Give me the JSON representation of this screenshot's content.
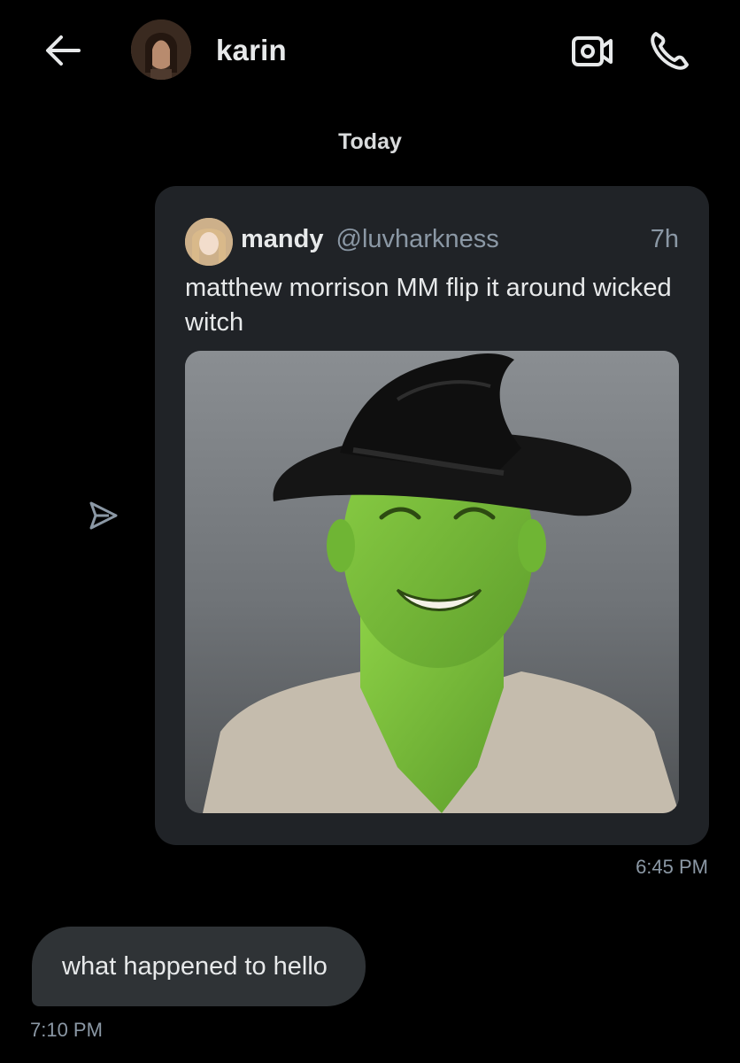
{
  "header": {
    "contact_name": "karin",
    "back_icon": "arrow-left-icon",
    "video_icon": "video-camera-icon",
    "call_icon": "phone-icon"
  },
  "conversation": {
    "date_separator": "Today",
    "shared_post": {
      "author_name": "mandy",
      "author_handle": "@luvharkness",
      "age": "7h",
      "text": "matthew morrison MM flip it around wicked witch",
      "image_description_icon": "photo",
      "sent_time": "6:45 PM"
    },
    "received_message": {
      "text": "what happened to hello",
      "time": "7:10 PM"
    }
  },
  "colors": {
    "background": "#000000",
    "card": "#202327",
    "bubble": "#2f3336",
    "primary_text": "#e7e9ea",
    "secondary_text": "#8b98a5"
  }
}
